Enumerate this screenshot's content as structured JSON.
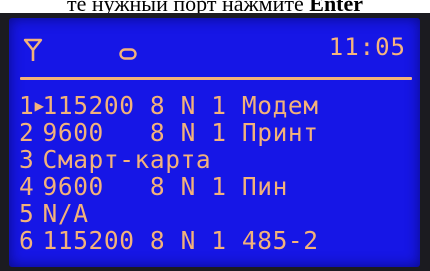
{
  "caption": {
    "text_before": "те нужный порт нажмите ",
    "key": "Enter"
  },
  "status_bar": {
    "time": "11:05",
    "icons": [
      "antenna-icon",
      "link-indicator-icon"
    ]
  },
  "cursor": "▶",
  "ports": [
    {
      "number": "1",
      "text": "115200 8 N 1 Модем"
    },
    {
      "number": "2",
      "text": "9600   8 N 1 Принт"
    },
    {
      "number": "3",
      "text": "Смарт-карта"
    },
    {
      "number": "4",
      "text": "9600   8 N 1 Пин"
    },
    {
      "number": "5",
      "text": "N/A"
    },
    {
      "number": "6",
      "text": "115200 8 N 1 485-2"
    }
  ],
  "colors": {
    "screen_background": "#1616e6",
    "text": "#f3b27a",
    "bezel": "#1b1b20"
  }
}
